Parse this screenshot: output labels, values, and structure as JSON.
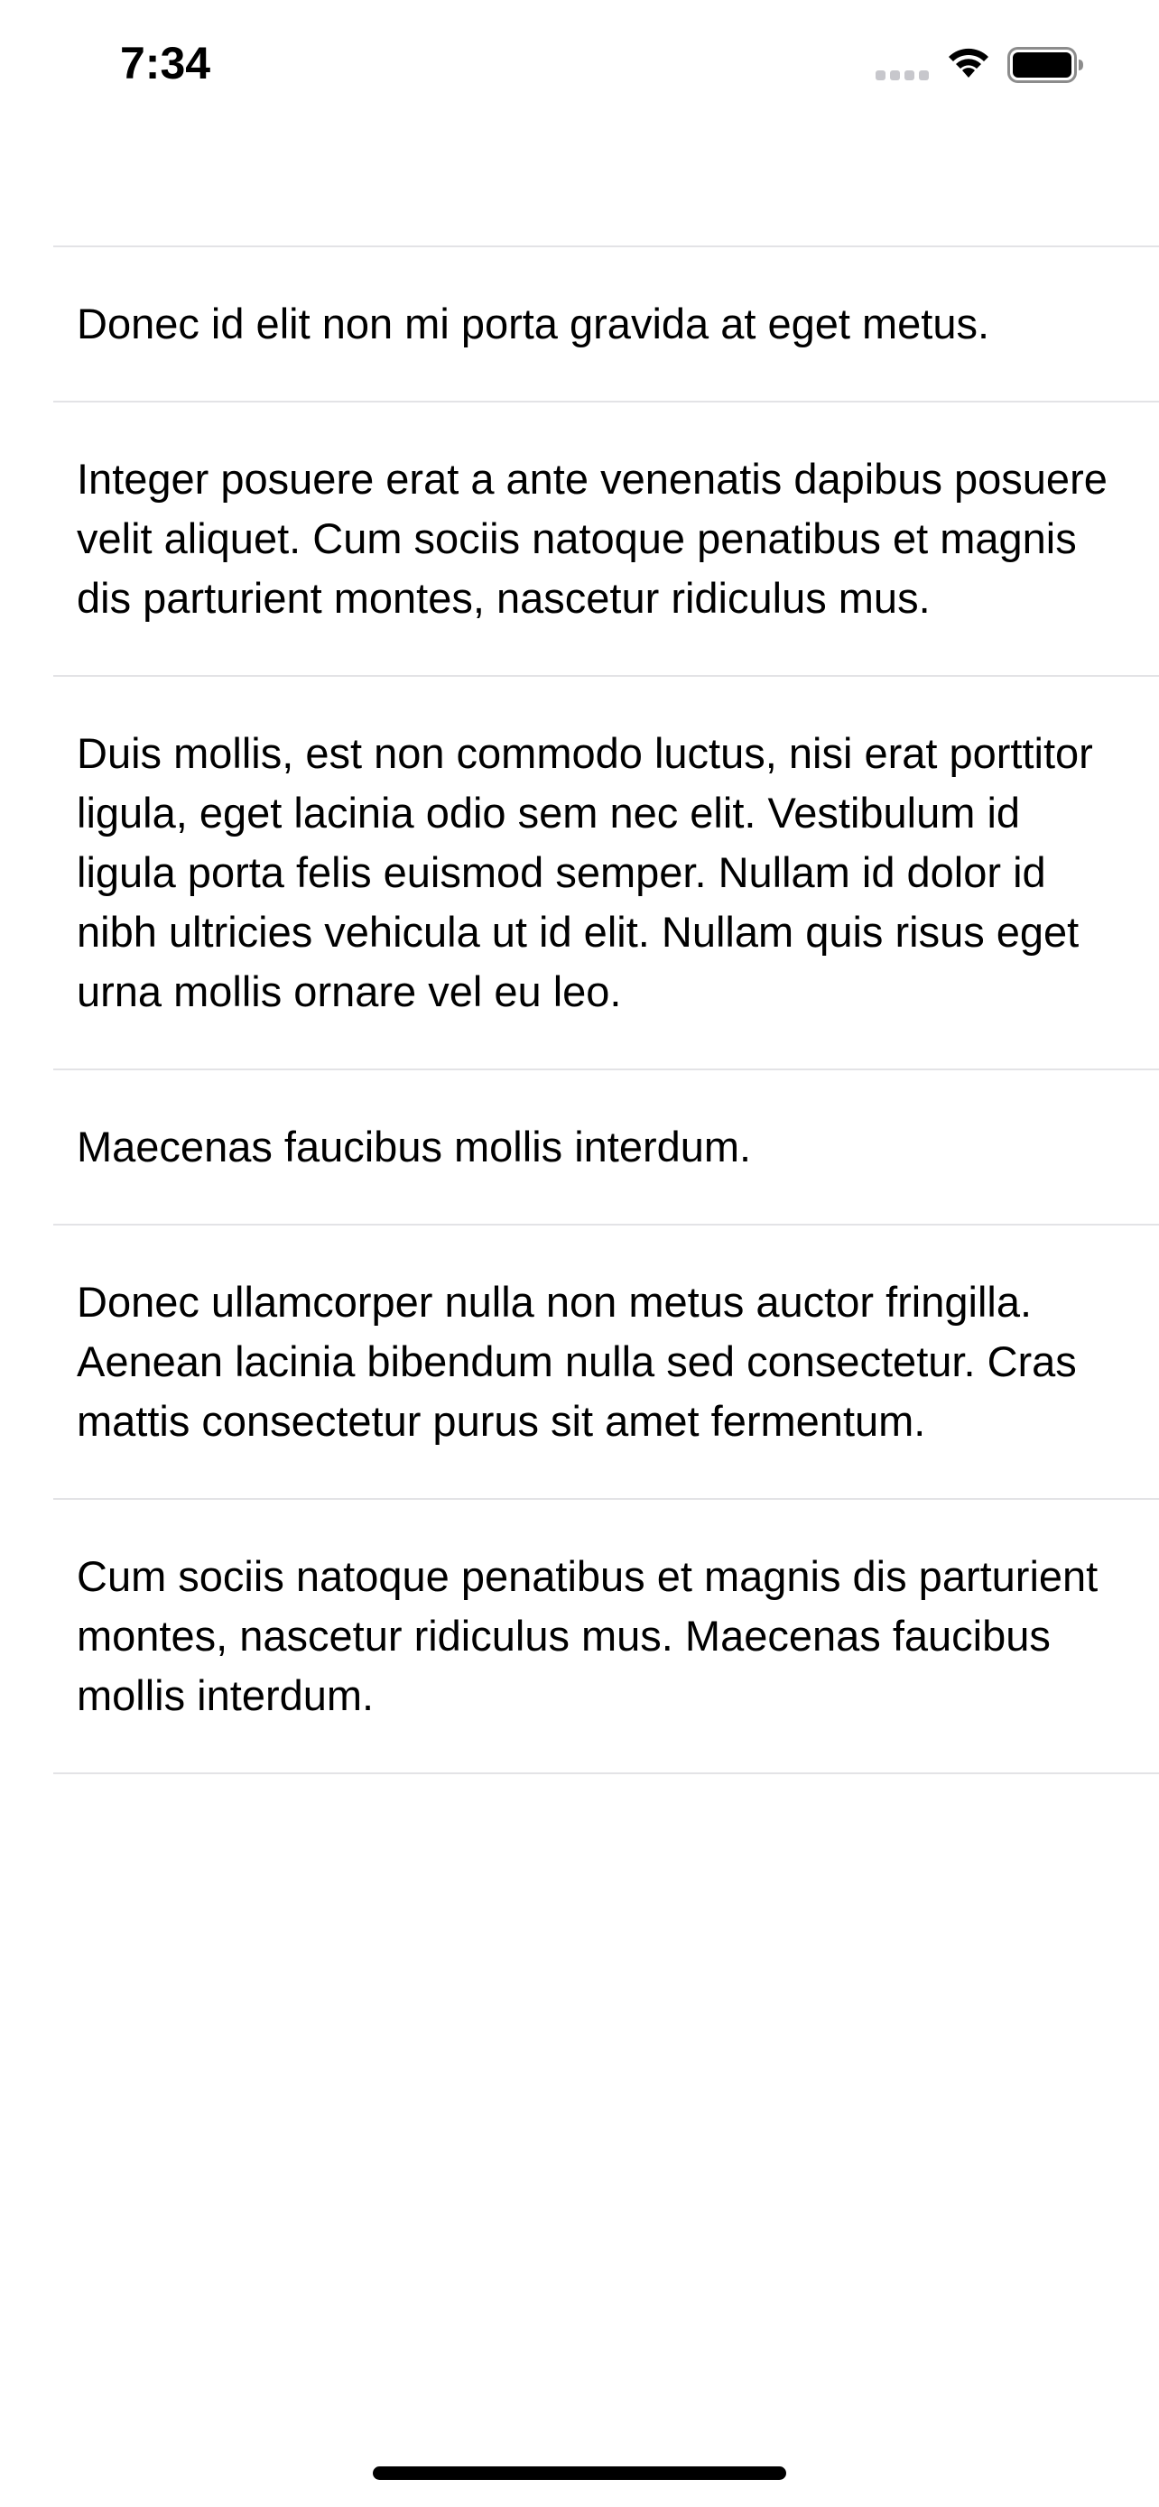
{
  "status_bar": {
    "time": "7:34",
    "icons": [
      "cellular-signal-icon",
      "wifi-icon",
      "battery-icon"
    ]
  },
  "list": {
    "items": [
      {
        "text": "Donec id elit non mi porta gravida at eget metus."
      },
      {
        "text": "Integer posuere erat a ante venenatis dapibus posuere velit aliquet. Cum sociis natoque penatibus et magnis dis parturient montes, nascetur ridiculus mus."
      },
      {
        "text": "Duis mollis, est non commodo luctus, nisi erat porttitor ligula, eget lacinia odio sem nec elit. Vestibulum id ligula porta felis euismod semper. Nullam id dolor id nibh ultricies vehicula ut id elit. Nullam quis risus eget urna mollis ornare vel eu leo."
      },
      {
        "text": "Maecenas faucibus mollis interdum."
      },
      {
        "text": "Donec ullamcorper nulla non metus auctor fringilla. Aenean lacinia bibendum nulla sed consectetur. Cras mattis consectetur purus sit amet fermentum."
      },
      {
        "text": "Cum sociis natoque penatibus et magnis dis parturient montes, nascetur ridiculus mus. Maecenas faucibus mollis interdum."
      }
    ]
  },
  "colors": {
    "separator": "#e3e3e6",
    "text": "#000000",
    "background": "#ffffff",
    "inactive_signal": "#c7c7cc"
  }
}
